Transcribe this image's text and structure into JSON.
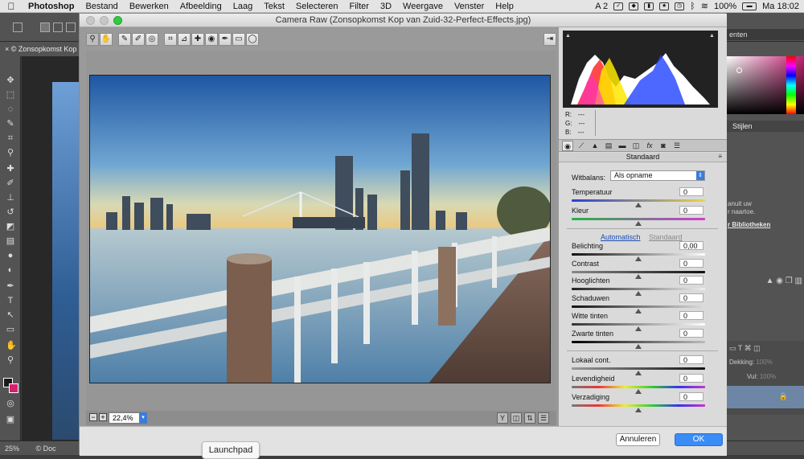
{
  "menubar": {
    "apple": "",
    "items": [
      "Photoshop",
      "Bestand",
      "Bewerken",
      "Afbeelding",
      "Laag",
      "Tekst",
      "Selecteren",
      "Filter",
      "3D",
      "Weergave",
      "Venster",
      "Help"
    ],
    "right": {
      "a2": "A 2",
      "battery": "100%",
      "time": "Ma 18:02"
    }
  },
  "photoshop": {
    "doc_tab": "© Zonsopkomst Kop",
    "status_zoom": "25%",
    "status_doc": "© Doc",
    "right_top_field": "enten",
    "styles_tab": "Stijlen",
    "lib_text1": "anuit uw",
    "lib_text2": "r naartoe.",
    "lib_link": "r Bibliotheken",
    "dekking": "Dekking:",
    "dekking_val": "100%",
    "vul": "Vul:",
    "vul_val": "100%"
  },
  "camera_raw": {
    "title": "Camera Raw (Zonsopkomst Kop van Zuid-32-Perfect-Effects.jpg)",
    "zoom": "22,4%",
    "buttons": {
      "cancel": "Annuleren",
      "ok": "OK"
    },
    "launchpad": "Launchpad",
    "rgb": {
      "r_label": "R:",
      "g_label": "G:",
      "b_label": "B:",
      "r": "---",
      "g": "---",
      "b": "---"
    },
    "panel_title": "Standaard",
    "white_balance": {
      "label": "Witbalans:",
      "value": "Als opname"
    },
    "toggle_auto": "Automatisch",
    "toggle_default": "Standaard",
    "sliders": [
      {
        "label": "Temperatuur",
        "value": "0"
      },
      {
        "label": "Kleur",
        "value": "0"
      },
      {
        "label": "Belichting",
        "value": "0,00"
      },
      {
        "label": "Contrast",
        "value": "0"
      },
      {
        "label": "Hooglichten",
        "value": "0"
      },
      {
        "label": "Schaduwen",
        "value": "0"
      },
      {
        "label": "Witte tinten",
        "value": "0"
      },
      {
        "label": "Zwarte tinten",
        "value": "0"
      },
      {
        "label": "Lokaal cont.",
        "value": "0"
      },
      {
        "label": "Levendigheid",
        "value": "0"
      },
      {
        "label": "Verzadiging",
        "value": "0"
      }
    ]
  },
  "colors": {
    "ok_blue": "#3a8cf6",
    "link_blue": "#1a4fb3",
    "select_blue": "#3b7cdb"
  }
}
